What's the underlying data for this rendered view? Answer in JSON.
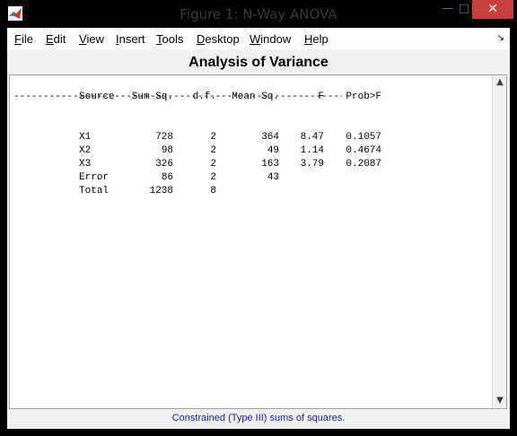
{
  "window": {
    "title": "Figure 1: N-Way ANOVA",
    "controls": {
      "minimize": "—",
      "maximize": "□",
      "close": "✕"
    }
  },
  "menu": [
    {
      "label": "File",
      "mnemonic": "F",
      "rest": "ile"
    },
    {
      "label": "Edit",
      "mnemonic": "E",
      "rest": "dit"
    },
    {
      "label": "View",
      "mnemonic": "V",
      "rest": "iew"
    },
    {
      "label": "Insert",
      "mnemonic": "I",
      "rest": "nsert"
    },
    {
      "label": "Tools",
      "mnemonic": "T",
      "rest": "ools"
    },
    {
      "label": "Desktop",
      "mnemonic": "D",
      "rest": "esktop"
    },
    {
      "label": "Window",
      "mnemonic": "W",
      "rest": "indow"
    },
    {
      "label": "Help",
      "mnemonic": "H",
      "rest": "elp"
    }
  ],
  "figure": {
    "heading": "Analysis of Variance",
    "footer": "Constrained (Type III) sums of squares."
  },
  "anova": {
    "headers": [
      "Source",
      "Sum Sq.",
      "d.f.",
      "Mean Sq.",
      "F",
      "Prob>F"
    ],
    "separator": "------------------------------------------------------------",
    "rows": [
      [
        "X1",
        "728",
        "2",
        "364",
        "8.47",
        "0.1057"
      ],
      [
        "X2",
        "98",
        "2",
        "49",
        "1.14",
        "0.4674"
      ],
      [
        "X3",
        "326",
        "2",
        "163",
        "3.79",
        "0.2087"
      ],
      [
        "Error",
        "86",
        "2",
        "43",
        "",
        ""
      ],
      [
        "Total",
        "1238",
        "8",
        "",
        "",
        ""
      ]
    ]
  },
  "icons": {
    "app": "matlab-icon",
    "dock": "dock-arrow-icon",
    "scroll_up": "scroll-up-icon",
    "scroll_down": "scroll-down-icon"
  },
  "colors": {
    "close_button": "#c7403b",
    "footer_text": "#1a1aa8",
    "figure_background": "#f0f0f0"
  }
}
